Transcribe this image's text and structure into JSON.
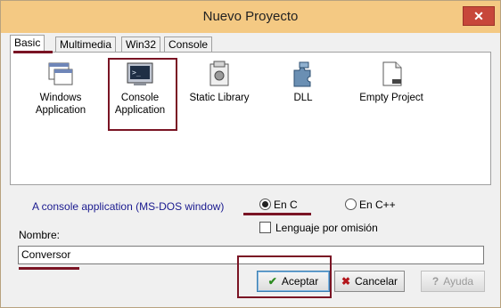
{
  "window": {
    "title": "Nuevo Proyecto",
    "close_label": "✕"
  },
  "tabs": [
    {
      "label": "Basic",
      "active": true
    },
    {
      "label": "Multimedia",
      "active": false
    },
    {
      "label": "Win32",
      "active": false
    },
    {
      "label": "Console",
      "active": false
    }
  ],
  "templates": [
    {
      "line1": "Windows",
      "line2": "Application",
      "icon": "windows-app-icon"
    },
    {
      "line1": "Console",
      "line2": "Application",
      "icon": "console-app-icon",
      "selected": true
    },
    {
      "line1": "Static Library",
      "line2": "",
      "icon": "static-library-icon"
    },
    {
      "line1": "DLL",
      "line2": "",
      "icon": "dll-icon"
    },
    {
      "line1": "Empty Project",
      "line2": "",
      "icon": "empty-project-icon"
    }
  ],
  "description": "A console application (MS-DOS window)",
  "language": {
    "options": [
      {
        "label": "En C",
        "selected": true
      },
      {
        "label": "En C++",
        "selected": false
      }
    ],
    "default_checkbox": {
      "label": "Lenguaje por omisión",
      "checked": false
    }
  },
  "name_field": {
    "label": "Nombre:",
    "value": "Conversor"
  },
  "buttons": {
    "accept": "Aceptar",
    "cancel": "Cancelar",
    "help": "Ayuda"
  },
  "colors": {
    "titlebar": "#f4c983",
    "annotation": "#7a1424",
    "description_text": "#1a1a8f"
  }
}
